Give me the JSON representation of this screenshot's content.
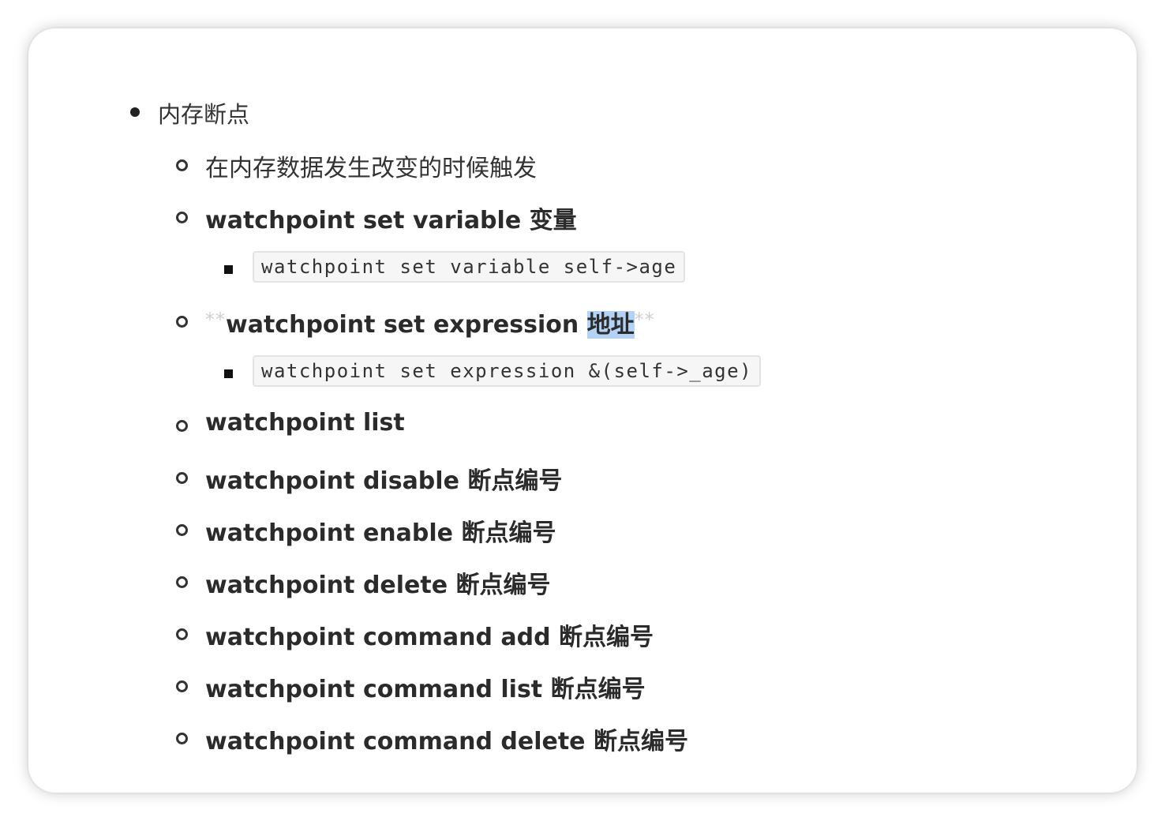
{
  "list": {
    "level1": {
      "label": "内存断点"
    },
    "items": [
      {
        "kind": "text",
        "label": "在内存数据发生改变的时候触发"
      },
      {
        "kind": "bold",
        "label": "watchpoint set variable 变量"
      },
      {
        "kind": "code",
        "label": "watchpoint set variable self->age"
      },
      {
        "kind": "bold-highlight",
        "prefix_marker": "**",
        "label": "watchpoint set expression ",
        "highlighted": "地址",
        "suffix_marker": "**"
      },
      {
        "kind": "code",
        "label": "watchpoint set expression &(self->_age)"
      },
      {
        "kind": "bold",
        "label": "watchpoint list"
      },
      {
        "kind": "bold",
        "label": "watchpoint disable 断点编号"
      },
      {
        "kind": "bold",
        "label": "watchpoint enable 断点编号"
      },
      {
        "kind": "bold",
        "label": "watchpoint delete 断点编号"
      },
      {
        "kind": "bold",
        "label": "watchpoint command add 断点编号"
      },
      {
        "kind": "bold",
        "label": "watchpoint command list 断点编号"
      },
      {
        "kind": "bold",
        "label": "watchpoint command delete 断点编号"
      }
    ]
  },
  "colors": {
    "text": "#333333",
    "highlight": "#b3d2f5",
    "code_background": "#f6f6f6",
    "code_border": "#e3e3e3",
    "markdown_marker": "#cfcfcf"
  }
}
